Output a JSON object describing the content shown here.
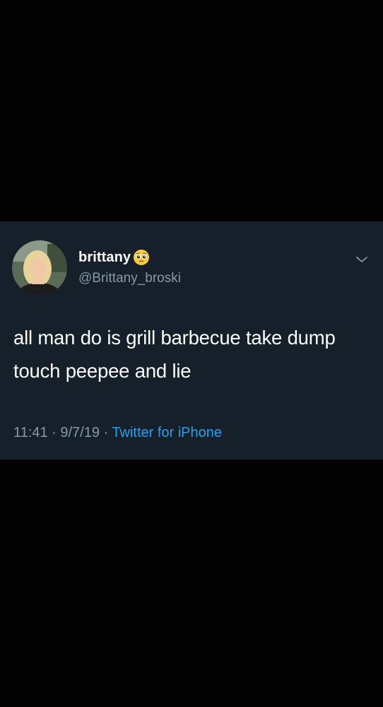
{
  "tweet": {
    "display_name": "brittany",
    "handle": "@Brittany_broski",
    "text": "all man do is grill barbecue take dump touch peepee and lie",
    "time": "11:41",
    "separator_1": " · ",
    "date": "9/7/19",
    "separator_2": " · ",
    "source": "Twitter for iPhone",
    "name_emoji": "pleading-face-emoji",
    "menu_icon": "chevron-down-icon"
  },
  "colors": {
    "page_background": "#020203",
    "tweet_background": "#15202b",
    "text_primary": "#ffffff",
    "text_secondary": "#8899a6",
    "link": "#1da1f2"
  }
}
